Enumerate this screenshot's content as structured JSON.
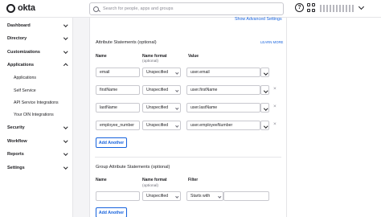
{
  "header": {
    "logo_text": "okta",
    "search_placeholder": "Search for people, apps and groups"
  },
  "sidebar": {
    "items": [
      {
        "label": "Dashboard"
      },
      {
        "label": "Directory"
      },
      {
        "label": "Customizations"
      },
      {
        "label": "Applications"
      },
      {
        "label": "Security"
      },
      {
        "label": "Workflow"
      },
      {
        "label": "Reports"
      },
      {
        "label": "Settings"
      }
    ],
    "sub_items": [
      {
        "label": "Applications"
      },
      {
        "label": "Self Service"
      },
      {
        "label": "API Service Integrations"
      },
      {
        "label": "Your OIN Integrations"
      }
    ]
  },
  "main": {
    "show_advanced_link": "Show Advanced Settings",
    "attribute_statements": {
      "title": "Attribute Statements (optional)",
      "learn_more": "LEARN MORE",
      "col_name": "Name",
      "col_format": "Name format",
      "col_format_sub": "(optional)",
      "col_value": "Value",
      "rows": [
        {
          "name": "email",
          "format": "Unspecified",
          "value": "user.email"
        },
        {
          "name": "firstName",
          "format": "Unspecified",
          "value": "user.firstName"
        },
        {
          "name": "lastName",
          "format": "Unspecified",
          "value": "user.lastName"
        },
        {
          "name": "employee_number",
          "format": "Unspecified",
          "value": "user.employeeNumber"
        }
      ],
      "add_another": "Add Another",
      "remove_glyph": "×"
    },
    "group_attribute_statements": {
      "title": "Group Attribute Statements (optional)",
      "col_name": "Name",
      "col_format": "Name format",
      "col_format_sub": "(optional)",
      "col_filter": "Filter",
      "row": {
        "name": "",
        "format": "Unspecified",
        "filter_type": "Starts with",
        "filter_value": ""
      },
      "add_another": "Add Another"
    }
  },
  "colors": {
    "accent": "#1662dd",
    "text": "#1d1d21",
    "border": "#c9c9cf",
    "background": "#f4f4f6"
  }
}
